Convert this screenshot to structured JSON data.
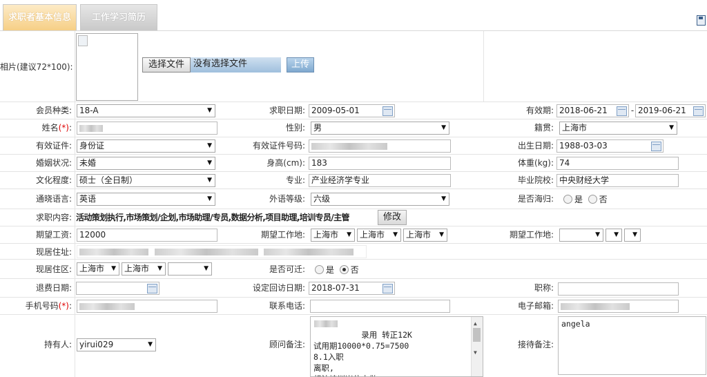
{
  "tabs": {
    "basic": "求职者基本信息",
    "work": "工作学习简历"
  },
  "photo": {
    "label": "相片(建议72*100):",
    "choose_btn": "选择文件",
    "no_file": "没有选择文件",
    "upload_btn": "上传"
  },
  "fields": {
    "member_type": {
      "label": "会员种类:",
      "value": "18-A"
    },
    "apply_date": {
      "label": "求职日期:",
      "value": "2009-05-01"
    },
    "valid_period": {
      "label": "有效期:",
      "from": "2018-06-21",
      "sep": "-",
      "to": "2019-06-21"
    },
    "name": {
      "label": "姓名",
      "req": "(*)",
      "colon": ":"
    },
    "gender": {
      "label": "性别:",
      "value": "男"
    },
    "hometown": {
      "label": "籍贯:",
      "value": "上海市"
    },
    "id_type": {
      "label": "有效证件:",
      "value": "身份证"
    },
    "id_number": {
      "label": "有效证件号码:"
    },
    "birth": {
      "label": "出生日期:",
      "value": "1988-03-03"
    },
    "marital": {
      "label": "婚姻状况:",
      "value": "未婚"
    },
    "height": {
      "label": "身高(cm):",
      "value": "183"
    },
    "weight": {
      "label": "体重(kg):",
      "value": "74"
    },
    "education": {
      "label": "文化程度:",
      "value": "硕士（全日制）"
    },
    "major": {
      "label": "专业:",
      "value": "产业经济学专业"
    },
    "school": {
      "label": "毕业院校:",
      "value": "中央财经大学"
    },
    "language": {
      "label": "通晓语言:",
      "value": "英语"
    },
    "foreign_level": {
      "label": "外语等级:",
      "value": "六级"
    },
    "returnee": {
      "label": "是否海归:",
      "yes": "是",
      "no": "否"
    },
    "job_content": {
      "label": "求职内容:",
      "value": "活动策划执行,市场策划/企划,市场助理/专员,数据分析,项目助理,培训专员/主管",
      "edit_btn": "修改"
    },
    "salary": {
      "label": "期望工资:",
      "value": "12000"
    },
    "work_place": {
      "label": "期望工作地:",
      "v1": "上海市",
      "v2": "上海市",
      "v3": "上海市"
    },
    "work_place2": {
      "label": "期望工作地:"
    },
    "address": {
      "label": "现居住址:"
    },
    "district": {
      "label": "现居住区:",
      "v1": "上海市",
      "v2": "上海市"
    },
    "relocate": {
      "label": "是否可迁:",
      "yes": "是",
      "no": "否"
    },
    "refund_date": {
      "label": "退费日期:"
    },
    "callback_date": {
      "label": "设定回访日期:",
      "value": "2018-07-31"
    },
    "title": {
      "label": "职称:"
    },
    "mobile": {
      "label": "手机号码",
      "req": "(*)",
      "colon": ":"
    },
    "phone": {
      "label": "联系电话:"
    },
    "email": {
      "label": "电子邮箱:"
    },
    "holder": {
      "label": "持有人:",
      "value": "yirui029"
    },
    "advisor_note": {
      "label": "顾问备注:",
      "value": "      录用 转正12K\n试用期10000*0.75=7500\n8.1入职\n离职,\n想法培训岗位去做。"
    },
    "reception_note": {
      "label": "接待备注:",
      "value": "angela"
    }
  }
}
